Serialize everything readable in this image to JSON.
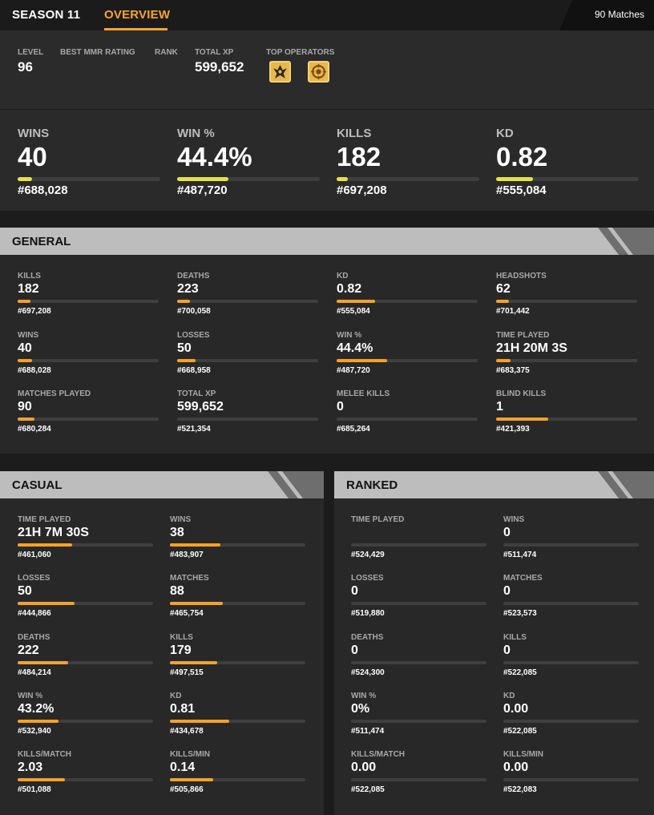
{
  "nav": {
    "season_tab": "SEASON 11",
    "overview_tab": "OVERVIEW",
    "matches": "90 Matches"
  },
  "header": {
    "level_label": "LEVEL",
    "level_value": "96",
    "mmr_label": "BEST MMR RATING",
    "rank_label": "RANK",
    "xp_label": "TOTAL XP",
    "xp_value": "599,652",
    "operators_label": "TOP OPERATORS",
    "operator_icons": [
      "operator-badge-icon",
      "operator-badge-icon"
    ]
  },
  "colors": {
    "accent": "#f9a42a",
    "summary_bar": "#e6e04a",
    "stat_bar": "#f3a227",
    "panel_header": "#bdbdbd"
  },
  "summary": [
    {
      "label": "WINS",
      "value": "40",
      "rank": "#688,028",
      "progress": 0.1
    },
    {
      "label": "WIN %",
      "value": "44.4%",
      "rank": "#487,720",
      "progress": 0.36
    },
    {
      "label": "KILLS",
      "value": "182",
      "rank": "#697,208",
      "progress": 0.08
    },
    {
      "label": "KD",
      "value": "0.82",
      "rank": "#555,084",
      "progress": 0.26
    }
  ],
  "general": {
    "title": "GENERAL",
    "stats": [
      {
        "label": "KILLS",
        "value": "182",
        "rank": "#697,208",
        "progress": 0.09
      },
      {
        "label": "DEATHS",
        "value": "223",
        "rank": "#700,058",
        "progress": 0.09
      },
      {
        "label": "KD",
        "value": "0.82",
        "rank": "#555,084",
        "progress": 0.27
      },
      {
        "label": "HEADSHOTS",
        "value": "62",
        "rank": "#701,442",
        "progress": 0.09
      },
      {
        "label": "WINS",
        "value": "40",
        "rank": "#688,028",
        "progress": 0.1
      },
      {
        "label": "LOSSES",
        "value": "50",
        "rank": "#668,958",
        "progress": 0.13
      },
      {
        "label": "WIN %",
        "value": "44.4%",
        "rank": "#487,720",
        "progress": 0.36
      },
      {
        "label": "TIME PLAYED",
        "value": "21H 20M 3S",
        "rank": "#683,375",
        "progress": 0.1
      },
      {
        "label": "MATCHES PLAYED",
        "value": "90",
        "rank": "#680,284",
        "progress": 0.12
      },
      {
        "label": "TOTAL XP",
        "value": "599,652",
        "rank": "#521,354",
        "progress": 0.0
      },
      {
        "label": "MELEE KILLS",
        "value": "0",
        "rank": "#685,264",
        "progress": 0.0
      },
      {
        "label": "BLIND KILLS",
        "value": "1",
        "rank": "#421,393",
        "progress": 0.37
      }
    ]
  },
  "casual": {
    "title": "CASUAL",
    "stats": [
      {
        "label": "TIME PLAYED",
        "value": "21H 7M 30S",
        "rank": "#461,060",
        "progress": 0.4
      },
      {
        "label": "WINS",
        "value": "38",
        "rank": "#483,907",
        "progress": 0.37
      },
      {
        "label": "LOSSES",
        "value": "50",
        "rank": "#444,866",
        "progress": 0.42
      },
      {
        "label": "MATCHES",
        "value": "88",
        "rank": "#465,754",
        "progress": 0.39
      },
      {
        "label": "DEATHS",
        "value": "222",
        "rank": "#484,214",
        "progress": 0.37
      },
      {
        "label": "KILLS",
        "value": "179",
        "rank": "#497,515",
        "progress": 0.35
      },
      {
        "label": "WIN %",
        "value": "43.2%",
        "rank": "#532,940",
        "progress": 0.3
      },
      {
        "label": "KD",
        "value": "0.81",
        "rank": "#434,678",
        "progress": 0.44
      },
      {
        "label": "KILLS/MATCH",
        "value": "2.03",
        "rank": "#501,088",
        "progress": 0.35
      },
      {
        "label": "KILLS/MIN",
        "value": "0.14",
        "rank": "#505,866",
        "progress": 0.32
      }
    ]
  },
  "ranked": {
    "title": "RANKED",
    "stats": [
      {
        "label": "TIME PLAYED",
        "value": "",
        "rank": "#524,429",
        "progress": 0.0
      },
      {
        "label": "WINS",
        "value": "0",
        "rank": "#511,474",
        "progress": 0.0
      },
      {
        "label": "LOSSES",
        "value": "0",
        "rank": "#519,880",
        "progress": 0.0
      },
      {
        "label": "MATCHES",
        "value": "0",
        "rank": "#523,573",
        "progress": 0.0
      },
      {
        "label": "DEATHS",
        "value": "0",
        "rank": "#524,300",
        "progress": 0.0
      },
      {
        "label": "KILLS",
        "value": "0",
        "rank": "#522,085",
        "progress": 0.0
      },
      {
        "label": "WIN %",
        "value": "0%",
        "rank": "#511,474",
        "progress": 0.0
      },
      {
        "label": "KD",
        "value": "0.00",
        "rank": "#522,085",
        "progress": 0.0
      },
      {
        "label": "KILLS/MATCH",
        "value": "0.00",
        "rank": "#522,085",
        "progress": 0.0
      },
      {
        "label": "KILLS/MIN",
        "value": "0.00",
        "rank": "#522,083",
        "progress": 0.0
      }
    ]
  }
}
